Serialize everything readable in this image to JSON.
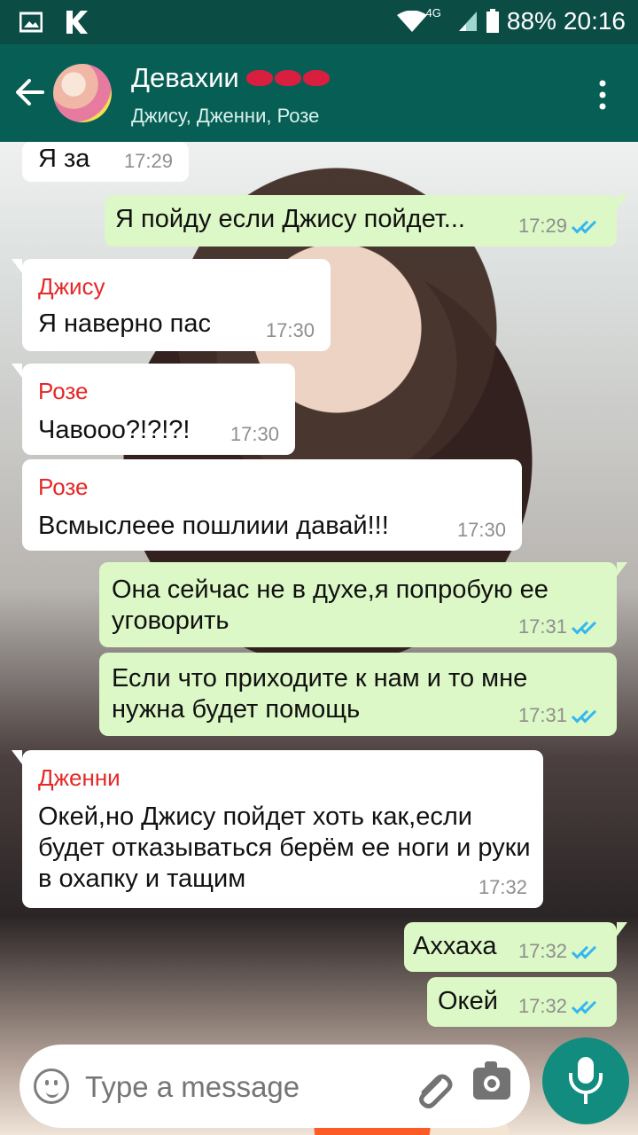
{
  "status": {
    "signal": "4G",
    "battery": "88%",
    "time": "20:16"
  },
  "header": {
    "title": "Девахии",
    "subtitle": "Джису, Дженни, Розе"
  },
  "messages": [
    {
      "text": "Я за",
      "time": "17:29"
    },
    {
      "text": "Я пойду если Джису пойдет...",
      "time": "17:29"
    },
    {
      "sender": "Джису",
      "text": "Я наверно  пас",
      "time": "17:30"
    },
    {
      "sender": "Розе",
      "text": "Чавооо?!?!?!",
      "time": "17:30"
    },
    {
      "sender": "Розе",
      "text": "Всмыслеее пошлиии давай!!!",
      "time": "17:30"
    },
    {
      "text": "Она сейчас не в духе,я попробую ее уговорить",
      "time": "17:31"
    },
    {
      "text": "Если что приходите к нам и то мне нужна будет помощь",
      "time": "17:31"
    },
    {
      "sender": "Дженни",
      "text": "Окей,но Джису пойдет хоть как,если будет отказываться берём ее ноги и руки в охапку и тащим",
      "time": "17:32"
    },
    {
      "text": "Аххаха",
      "time": "17:32"
    },
    {
      "text": "Окей",
      "time": "17:32"
    }
  ],
  "composer": {
    "placeholder": "Type a message"
  },
  "colors": {
    "appbar": "#075e54",
    "outgoing": "#dcf8c6",
    "incoming": "#ffffff",
    "sender": "#e52828",
    "ticks": "#34b7f1",
    "mic": "#128c7e"
  },
  "icons": [
    "back-arrow-icon",
    "more-vert-icon",
    "emoji-icon",
    "attach-icon",
    "camera-icon",
    "mic-icon"
  ]
}
